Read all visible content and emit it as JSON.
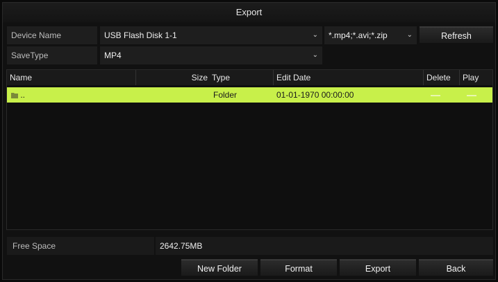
{
  "window": {
    "title": "Export"
  },
  "form": {
    "device_label": "Device Name",
    "device_value": "USB Flash Disk 1-1",
    "filter_value": "*.mp4;*.avi;*.zip",
    "refresh_label": "Refresh",
    "savetype_label": "SaveType",
    "savetype_value": "MP4"
  },
  "table": {
    "headers": {
      "name": "Name",
      "size": "Size",
      "type": "Type",
      "edit_date": "Edit Date",
      "delete": "Delete",
      "play": "Play"
    },
    "rows": [
      {
        "name": "..",
        "size": "",
        "type": "Folder",
        "edit_date": "01-01-1970 00:00:00"
      }
    ]
  },
  "footer": {
    "free_space_label": "Free Space",
    "free_space_value": "2642.75MB",
    "buttons": {
      "new_folder": "New Folder",
      "format": "Format",
      "export": "Export",
      "back": "Back"
    }
  },
  "colors": {
    "selected_row": "#c8f04a",
    "background": "#111111"
  },
  "icons": {
    "dropdown": "chevron-down-icon",
    "folder": "folder-icon"
  }
}
